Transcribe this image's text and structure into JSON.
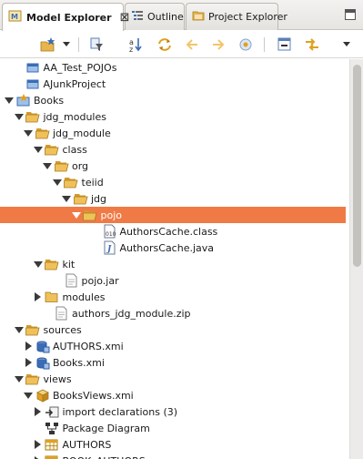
{
  "tabs": [
    {
      "label": "Model Explorer",
      "icon": "model-explorer-icon",
      "active": true,
      "close": "⊠"
    },
    {
      "label": "Outline",
      "icon": "outline-icon",
      "active": false
    },
    {
      "label": "Project Explorer",
      "icon": "project-explorer-icon",
      "active": false
    }
  ],
  "toolbar": {
    "buttons": [
      "new-model-icon",
      "dropdown-chevron-icon",
      "filter-icon",
      "sort-az-icon",
      "sync-icon",
      "back-arrow-icon",
      "forward-arrow-icon",
      "home-icon",
      "collapse-all-icon",
      "link-editor-icon",
      "view-menu-icon"
    ]
  },
  "colors": {
    "selection": "#f07a46",
    "folder": "#e8b54a",
    "accent": "#3b6db5"
  },
  "tree": [
    {
      "label": "AA_Test_POJOs",
      "depth": 1,
      "twisty": "none",
      "icon": "project-icon"
    },
    {
      "label": "AJunkProject",
      "depth": 1,
      "twisty": "none",
      "icon": "project-icon"
    },
    {
      "label": "Books",
      "depth": 0,
      "twisty": "expanded",
      "icon": "model-project-icon"
    },
    {
      "label": "jdg_modules",
      "depth": 1,
      "twisty": "expanded",
      "icon": "folder-open-icon"
    },
    {
      "label": "jdg_module",
      "depth": 2,
      "twisty": "expanded",
      "icon": "folder-open-icon"
    },
    {
      "label": "class",
      "depth": 3,
      "twisty": "expanded",
      "icon": "folder-open-icon"
    },
    {
      "label": "org",
      "depth": 4,
      "twisty": "expanded",
      "icon": "folder-open-icon"
    },
    {
      "label": "teiid",
      "depth": 5,
      "twisty": "expanded",
      "icon": "folder-open-icon"
    },
    {
      "label": "jdg",
      "depth": 6,
      "twisty": "expanded",
      "icon": "folder-open-icon"
    },
    {
      "label": "pojo",
      "depth": 7,
      "twisty": "expanded",
      "icon": "folder-open-icon",
      "selected": true
    },
    {
      "label": "AuthorsCache.class",
      "depth": 9,
      "twisty": "none",
      "icon": "class-file-icon"
    },
    {
      "label": "AuthorsCache.java",
      "depth": 9,
      "twisty": "none",
      "icon": "java-file-icon"
    },
    {
      "label": "kit",
      "depth": 3,
      "twisty": "expanded",
      "icon": "folder-open-icon"
    },
    {
      "label": "pojo.jar",
      "depth": 5,
      "twisty": "none",
      "icon": "file-icon"
    },
    {
      "label": "modules",
      "depth": 3,
      "twisty": "collapsed",
      "icon": "folder-icon"
    },
    {
      "label": "authors_jdg_module.zip",
      "depth": 4,
      "twisty": "none",
      "icon": "file-icon"
    },
    {
      "label": "sources",
      "depth": 1,
      "twisty": "expanded",
      "icon": "folder-open-icon"
    },
    {
      "label": "AUTHORS.xmi",
      "depth": 2,
      "twisty": "collapsed",
      "icon": "source-model-icon"
    },
    {
      "label": "Books.xmi",
      "depth": 2,
      "twisty": "collapsed",
      "icon": "source-model-icon"
    },
    {
      "label": "views",
      "depth": 1,
      "twisty": "expanded",
      "icon": "folder-open-icon"
    },
    {
      "label": "BooksViews.xmi",
      "depth": 2,
      "twisty": "expanded",
      "icon": "view-model-icon"
    },
    {
      "label": "import declarations (3)",
      "depth": 3,
      "twisty": "collapsed",
      "icon": "import-icon"
    },
    {
      "label": "Package Diagram",
      "depth": 3,
      "twisty": "none",
      "icon": "diagram-icon"
    },
    {
      "label": "AUTHORS",
      "depth": 3,
      "twisty": "collapsed",
      "icon": "table-icon"
    },
    {
      "label": "BOOK_AUTHORS",
      "depth": 3,
      "twisty": "collapsed",
      "icon": "table-icon"
    }
  ]
}
